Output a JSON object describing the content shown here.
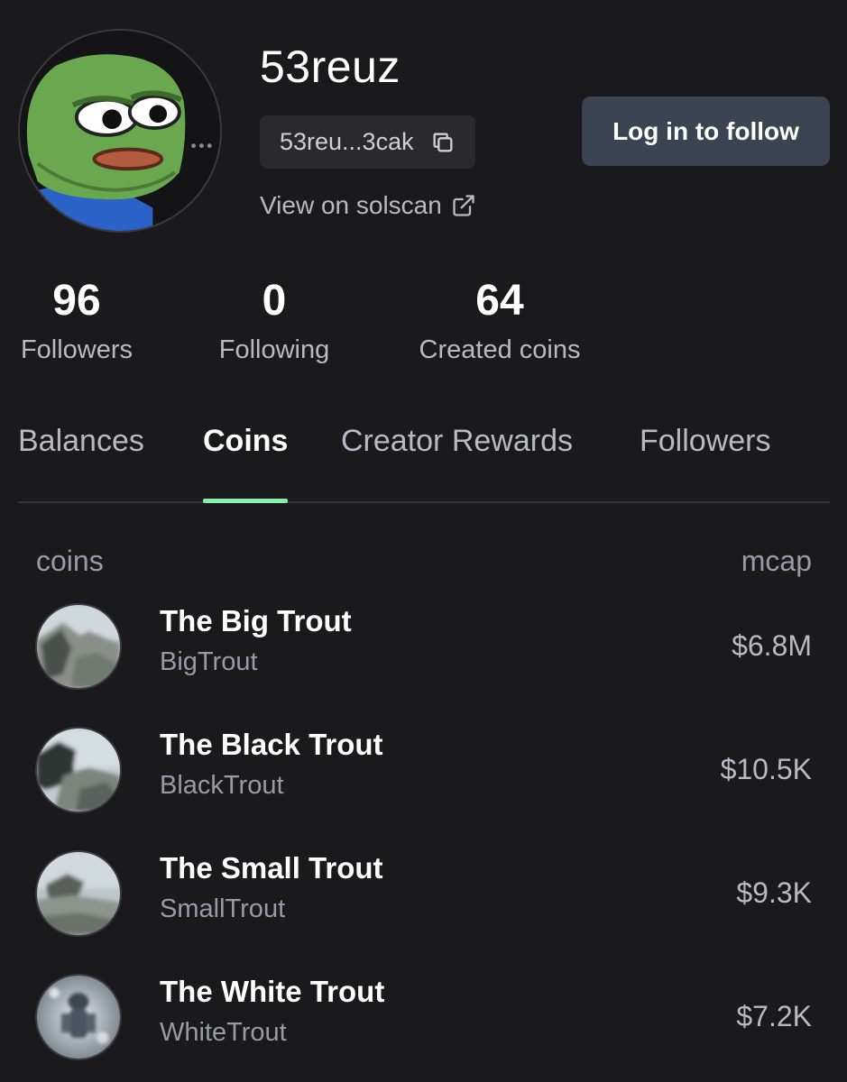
{
  "profile": {
    "username": "53reuz",
    "address_short": "53reu...3cak",
    "solscan_label": "View on solscan",
    "follow_label": "Log in to follow",
    "avatar_icon": "frog-avatar-icon"
  },
  "stats": [
    {
      "value": "96",
      "label": "Followers"
    },
    {
      "value": "0",
      "label": "Following"
    },
    {
      "value": "64",
      "label": "Created coins"
    }
  ],
  "tabs": [
    {
      "label": "Balances",
      "active": false
    },
    {
      "label": "Coins",
      "active": true
    },
    {
      "label": "Creator Rewards",
      "active": false
    },
    {
      "label": "Followers",
      "active": false
    }
  ],
  "table": {
    "col_coins": "coins",
    "col_mcap": "mcap",
    "rows": [
      {
        "name": "The Big Trout",
        "ticker": "BigTrout",
        "mcap": "$6.8M"
      },
      {
        "name": "The Black Trout",
        "ticker": "BlackTrout",
        "mcap": "$10.5K"
      },
      {
        "name": "The Small Trout",
        "ticker": "SmallTrout",
        "mcap": "$9.3K"
      },
      {
        "name": "The White Trout",
        "ticker": "WhiteTrout",
        "mcap": "$7.2K"
      }
    ]
  },
  "colors": {
    "background": "#1a1a1c",
    "accent": "#86efac",
    "button": "#3a4452",
    "muted_text": "#b9b9c0"
  }
}
